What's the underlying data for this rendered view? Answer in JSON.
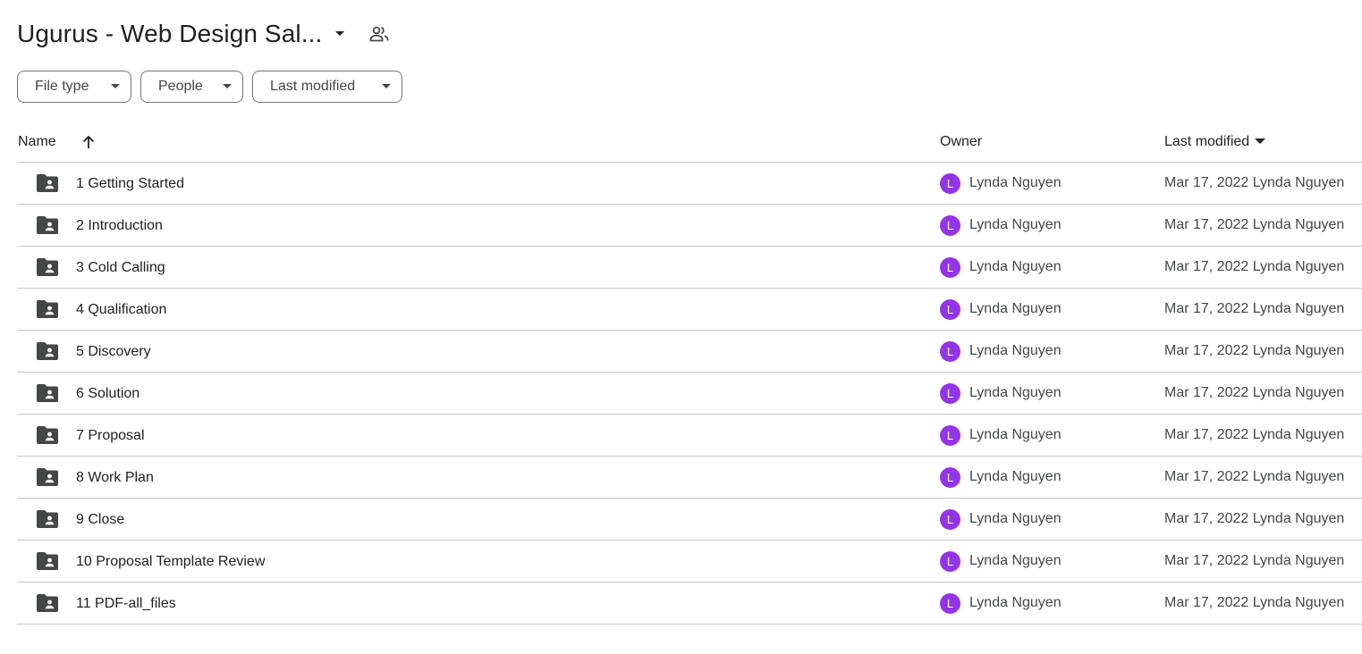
{
  "header": {
    "title": "Ugurus - Web Design Sal...",
    "title_caret_icon": "caret-down-icon",
    "share_icon": "people-icon"
  },
  "filters": [
    {
      "label": "File type"
    },
    {
      "label": "People"
    },
    {
      "label": "Last modified"
    }
  ],
  "table": {
    "columns": {
      "name": "Name",
      "owner": "Owner",
      "last_modified": "Last modified"
    },
    "sort_icon": "arrow-up-icon",
    "rows": [
      {
        "name": "1 Getting Started",
        "avatar": "L",
        "owner": "Lynda Nguyen",
        "modified": "Mar 17, 2022 Lynda Nguyen"
      },
      {
        "name": "2 Introduction",
        "avatar": "L",
        "owner": "Lynda Nguyen",
        "modified": "Mar 17, 2022 Lynda Nguyen"
      },
      {
        "name": "3 Cold Calling",
        "avatar": "L",
        "owner": "Lynda Nguyen",
        "modified": "Mar 17, 2022 Lynda Nguyen"
      },
      {
        "name": "4 Qualification",
        "avatar": "L",
        "owner": "Lynda Nguyen",
        "modified": "Mar 17, 2022 Lynda Nguyen"
      },
      {
        "name": "5 Discovery",
        "avatar": "L",
        "owner": "Lynda Nguyen",
        "modified": "Mar 17, 2022 Lynda Nguyen"
      },
      {
        "name": "6 Solution",
        "avatar": "L",
        "owner": "Lynda Nguyen",
        "modified": "Mar 17, 2022 Lynda Nguyen"
      },
      {
        "name": "7 Proposal",
        "avatar": "L",
        "owner": "Lynda Nguyen",
        "modified": "Mar 17, 2022 Lynda Nguyen"
      },
      {
        "name": "8 Work Plan",
        "avatar": "L",
        "owner": "Lynda Nguyen",
        "modified": "Mar 17, 2022 Lynda Nguyen"
      },
      {
        "name": "9 Close",
        "avatar": "L",
        "owner": "Lynda Nguyen",
        "modified": "Mar 17, 2022 Lynda Nguyen"
      },
      {
        "name": "10 Proposal Template Review",
        "avatar": "L",
        "owner": "Lynda Nguyen",
        "modified": "Mar 17, 2022 Lynda Nguyen"
      },
      {
        "name": "11 PDF-all_files",
        "avatar": "L",
        "owner": "Lynda Nguyen",
        "modified": "Mar 17, 2022 Lynda Nguyen"
      }
    ]
  },
  "colors": {
    "avatar_bg": "#9334e6",
    "text_primary": "#1f1f1f",
    "text_secondary": "#444746",
    "divider": "#c7c7c7",
    "folder_icon": "#444746"
  }
}
